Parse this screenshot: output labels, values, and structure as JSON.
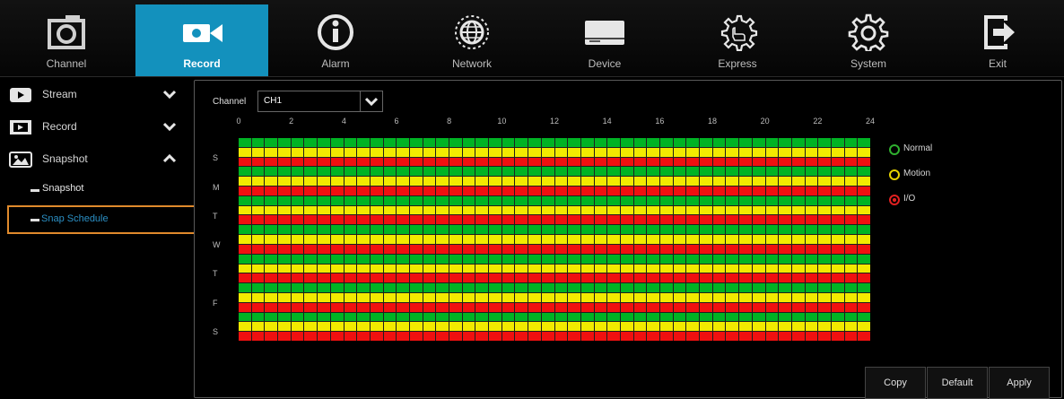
{
  "nav": {
    "tabs": [
      {
        "label": "Channel",
        "icon": "camera-icon",
        "active": false
      },
      {
        "label": "Record",
        "icon": "video-camera-icon",
        "active": true
      },
      {
        "label": "Alarm",
        "icon": "info-icon",
        "active": false
      },
      {
        "label": "Network",
        "icon": "globe-icon",
        "active": false
      },
      {
        "label": "Device",
        "icon": "hard-drive-icon",
        "active": false
      },
      {
        "label": "Express",
        "icon": "hand-gear-icon",
        "active": false
      },
      {
        "label": "System",
        "icon": "gear-icon",
        "active": false
      },
      {
        "label": "Exit",
        "icon": "exit-icon",
        "active": false
      }
    ],
    "active_color": "#1391bd"
  },
  "sidebar": {
    "items": [
      {
        "label": "Stream",
        "icon": "play-icon",
        "expanded": false
      },
      {
        "label": "Record",
        "icon": "film-icon",
        "expanded": false
      },
      {
        "label": "Snapshot",
        "icon": "photo-icon",
        "expanded": true
      }
    ],
    "sub_items": [
      {
        "label": "Snapshot",
        "selected": false
      },
      {
        "label": "Snap Schedule",
        "selected": true
      }
    ]
  },
  "schedule": {
    "channel_label": "Channel",
    "channel_value": "CH1",
    "hour_ticks": [
      "0",
      "2",
      "4",
      "6",
      "8",
      "10",
      "12",
      "14",
      "16",
      "18",
      "20",
      "22",
      "24"
    ],
    "days": [
      "S",
      "M",
      "T",
      "W",
      "T",
      "F",
      "S"
    ],
    "row_types": [
      "normal",
      "motion",
      "io"
    ],
    "colors": {
      "normal": "#00b324",
      "motion": "#f2ea00",
      "io": "#f01010"
    }
  },
  "legend": [
    {
      "label": "Normal",
      "color": "#2fb02f"
    },
    {
      "label": "Motion",
      "color": "#e6d200"
    },
    {
      "label": "I/O",
      "color": "#e02020"
    }
  ],
  "buttons": {
    "copy": "Copy",
    "default": "Default",
    "apply": "Apply"
  }
}
